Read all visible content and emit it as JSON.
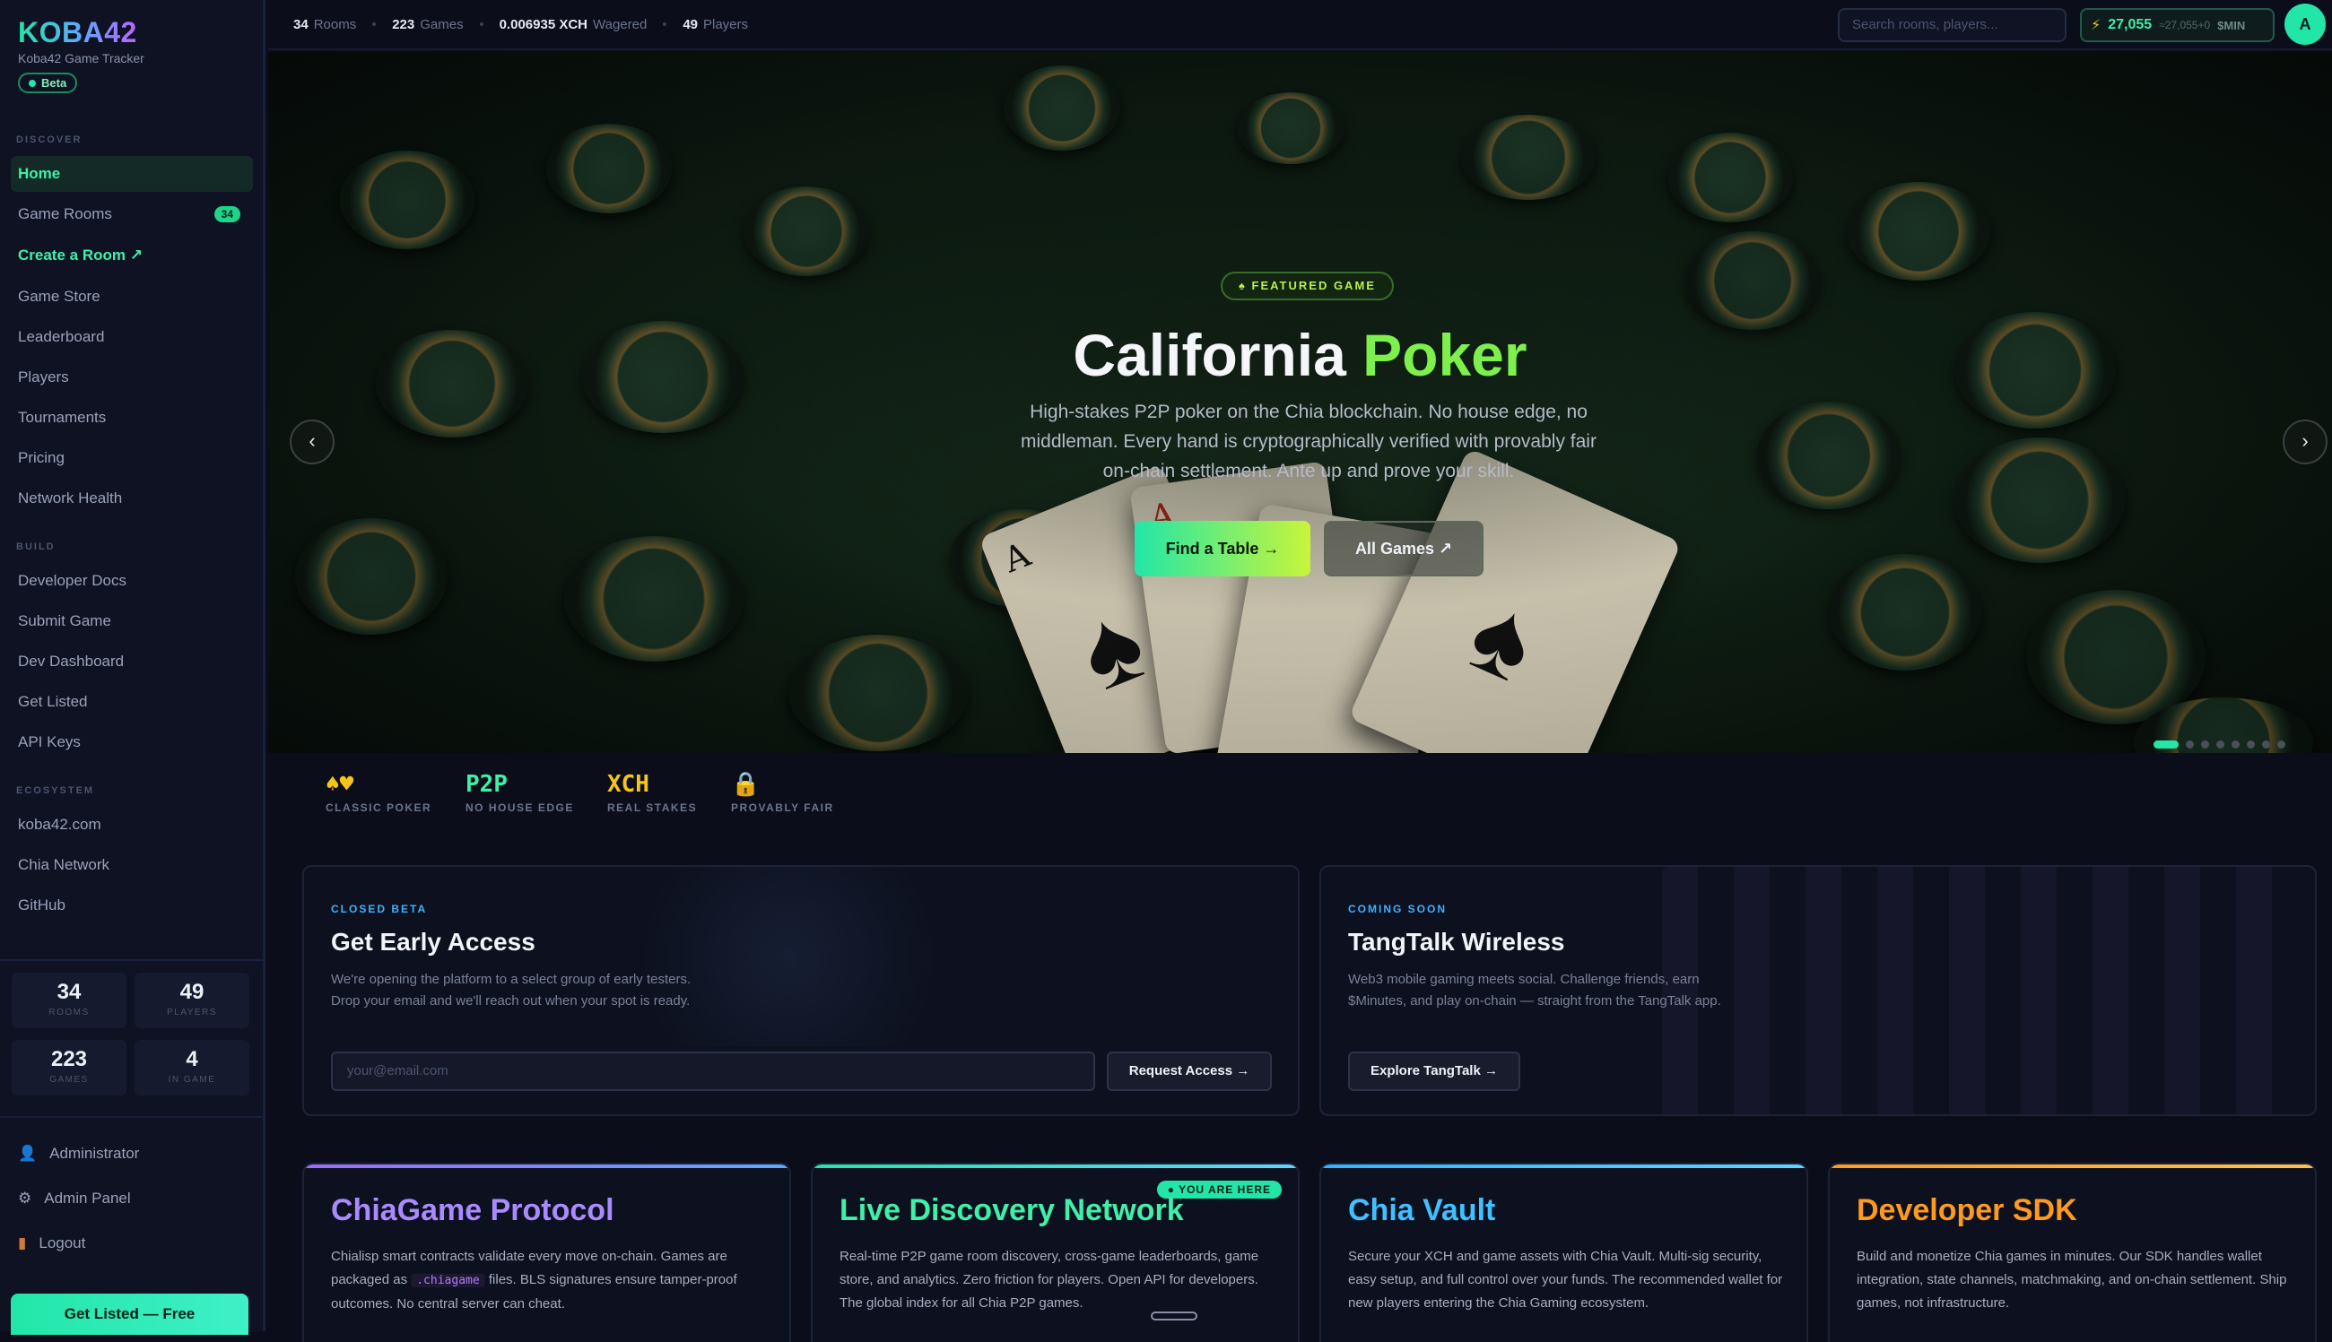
{
  "brand": {
    "name": "KOBA42",
    "subtitle": "Koba42 Game Tracker",
    "badge": "Beta"
  },
  "sidebar": {
    "sections": {
      "discover": "DISCOVER",
      "build": "BUILD",
      "ecosystem": "ECOSYSTEM"
    },
    "discover": [
      {
        "label": "Home",
        "active": true
      },
      {
        "label": "Game Rooms",
        "badge": "34"
      },
      {
        "label": "Create a Room ↗",
        "accent": true
      },
      {
        "label": "Game Store"
      },
      {
        "label": "Leaderboard"
      },
      {
        "label": "Players"
      },
      {
        "label": "Tournaments"
      },
      {
        "label": "Pricing"
      },
      {
        "label": "Network Health"
      }
    ],
    "build": [
      {
        "label": "Developer Docs"
      },
      {
        "label": "Submit Game"
      },
      {
        "label": "Dev Dashboard"
      },
      {
        "label": "Get Listed"
      },
      {
        "label": "API Keys"
      }
    ],
    "ecosystem": [
      {
        "label": "koba42.com"
      },
      {
        "label": "Chia Network"
      },
      {
        "label": "GitHub"
      }
    ],
    "stats": [
      {
        "value": "34",
        "label": "ROOMS"
      },
      {
        "value": "49",
        "label": "PLAYERS"
      },
      {
        "value": "223",
        "label": "GAMES"
      },
      {
        "value": "4",
        "label": "IN GAME"
      }
    ],
    "bottom": [
      {
        "icon": "user-icon",
        "label": "Administrator"
      },
      {
        "icon": "gear-icon",
        "label": "Admin Panel"
      },
      {
        "icon": "door-icon",
        "label": "Logout"
      }
    ],
    "cta": "Get Listed — Free"
  },
  "topbar": {
    "stats": [
      {
        "value": "34",
        "label": "Rooms"
      },
      {
        "value": "223",
        "label": "Games"
      },
      {
        "value": "0.006935 XCH",
        "label": "Wagered"
      },
      {
        "value": "49",
        "label": "Players"
      }
    ],
    "search_placeholder": "Search rooms, players...",
    "wallet": {
      "amount": "27,055",
      "sub": "≈27,055+0",
      "unit": "$MIN"
    },
    "avatar": "A"
  },
  "hero": {
    "eyebrow": "♠ FEATURED GAME",
    "title_a": "California ",
    "title_b": "Poker",
    "desc": "High-stakes P2P poker on the Chia blockchain. No house edge, no middleman. Every hand is cryptographically verified with provably fair on-chain settlement. Ante up and prove your skill.",
    "primary": "Find a Table →",
    "secondary": "All Games ↗",
    "prev": "‹",
    "next": "›",
    "slides": 8,
    "active_slide": 1
  },
  "features": [
    {
      "value": "♠♥",
      "label": "CLASSIC POKER",
      "color": "#f5c518"
    },
    {
      "value": "P2P",
      "label": "NO HOUSE EDGE",
      "color": "#3ff0a8"
    },
    {
      "value": "XCH",
      "label": "REAL STAKES",
      "color": "#f5c518"
    },
    {
      "value": "🔒",
      "label": "PROVABLY FAIR",
      "color": "#f5c518"
    }
  ],
  "early": {
    "eyebrow": "CLOSED BETA",
    "title": "Get Early Access",
    "desc": "We're opening the platform to a select group of early testers. Drop your email and we'll reach out when your spot is ready.",
    "placeholder": "your@email.com",
    "button": "Request Access →"
  },
  "tangtalk": {
    "eyebrow": "COMING SOON",
    "title": "TangTalk Wireless",
    "desc": "Web3 mobile gaming meets social. Challenge friends, earn $Minutes, and play on-chain — straight from the TangTalk app.",
    "button": "Explore TangTalk →"
  },
  "products": [
    {
      "title": "ChiaGame Protocol",
      "d1": "Chialisp smart contracts validate every move on-chain. Games are packaged as ",
      "code": ".chiagame",
      "d2": " files. BLS signatures ensure tamper-proof outcomes. No central server can cheat.",
      "color": "#9b6bff"
    },
    {
      "title": "Live Discovery Network",
      "desc": "Real-time P2P game room discovery, cross-game leaderboards, game store, and analytics. Zero friction for players. Open API for developers. The global index for all Chia P2P games.",
      "badge": "● YOU ARE HERE",
      "color": "#22e6a8"
    },
    {
      "title": "Chia Vault",
      "desc": "Secure your XCH and game assets with Chia Vault. Multi-sig security, easy setup, and full control over your funds. The recommended wallet for new players entering the Chia Gaming ecosystem.",
      "color": "#2fb6ff"
    },
    {
      "title": "Developer SDK",
      "desc": "Build and monetize Chia games in minutes. Our SDK handles wallet integration, state channels, matchmaking, and on-chain settlement. Ship games, not infrastructure.",
      "color": "#ff9a1f"
    }
  ]
}
